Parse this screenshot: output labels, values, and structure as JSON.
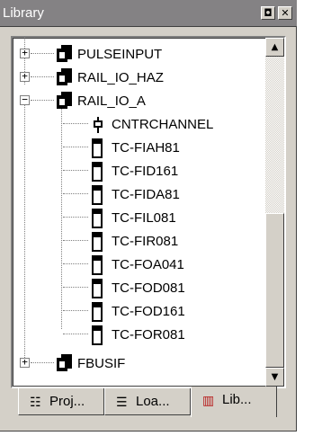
{
  "window": {
    "title": "Library",
    "dock_icon": "dock-toggle-icon",
    "close_icon": "close-icon"
  },
  "tree": {
    "items": [
      {
        "label": "PULSEINPUT",
        "level": 0,
        "expander": "+",
        "icon": "controller-icon"
      },
      {
        "label": "RAIL_IO_HAZ",
        "level": 0,
        "expander": "+",
        "icon": "controller-icon"
      },
      {
        "label": "RAIL_IO_A",
        "level": 0,
        "expander": "−",
        "icon": "controller-icon"
      },
      {
        "label": "CNTRCHANNEL",
        "level": 1,
        "icon": "channel-icon"
      },
      {
        "label": "TC-FIAH81",
        "level": 1,
        "icon": "io-card-icon"
      },
      {
        "label": "TC-FID161",
        "level": 1,
        "icon": "io-card-icon"
      },
      {
        "label": "TC-FIDA81",
        "level": 1,
        "icon": "io-card-icon"
      },
      {
        "label": "TC-FIL081",
        "level": 1,
        "icon": "io-card-icon"
      },
      {
        "label": "TC-FIR081",
        "level": 1,
        "icon": "io-card-icon"
      },
      {
        "label": "TC-FOA041",
        "level": 1,
        "icon": "io-card-icon"
      },
      {
        "label": "TC-FOD081",
        "level": 1,
        "icon": "io-card-icon"
      },
      {
        "label": "TC-FOD161",
        "level": 1,
        "icon": "io-card-icon"
      },
      {
        "label": "TC-FOR081",
        "level": 1,
        "icon": "io-card-icon"
      },
      {
        "label": "FBUSIF",
        "level": 0,
        "expander": "+",
        "icon": "controller-icon"
      }
    ]
  },
  "tabs": [
    {
      "label": "Proj...",
      "icon": "project-tree-icon",
      "active": false
    },
    {
      "label": "Loa...",
      "icon": "load-list-icon",
      "active": false
    },
    {
      "label": "Lib...",
      "icon": "library-books-icon",
      "active": true
    }
  ],
  "scrollbar": {
    "up_glyph": "▲",
    "down_glyph": "▼"
  }
}
